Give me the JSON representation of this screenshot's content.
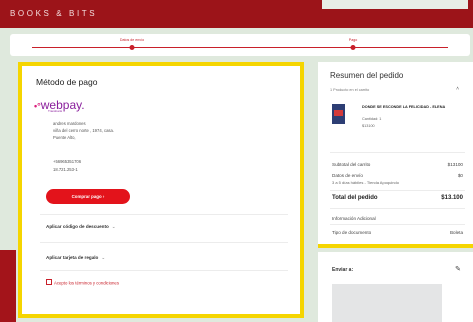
{
  "header": {
    "brand": "BOOKS & BITS"
  },
  "steps": [
    {
      "label": "Datos de envío"
    },
    {
      "label": "Pago"
    }
  ],
  "payment": {
    "title": "Método de pago",
    "provider": {
      "logo_prefix": "•°",
      "logo_text": "webpay.",
      "logo_sub": "Transbank"
    },
    "address_lines": [
      "andres mardones",
      "viña del cerro norte , 1974, casa.",
      "Puente Alto,"
    ],
    "contact_lines": [
      "+56965351706",
      "18.721.253-1"
    ],
    "pay_button": "Comprar pago  ›",
    "discount_link": "Aplicar código de descuento",
    "gift_link": "Aplicar tarjeta de regalo",
    "terms": "Acepto los términos y condiciones"
  },
  "summary": {
    "title": "Resumen del pedido",
    "count": "1 Producto en el carrito",
    "product": {
      "name": "DONDE SE ESCONDE LA FELICIDAD - ELENA",
      "qty": "Cantidad: 1",
      "price": "$13100"
    },
    "rows": [
      {
        "label": "Subtotal del carrito",
        "value": "$13100"
      },
      {
        "label": "Datos de envío",
        "value": "$0"
      }
    ],
    "shipping_note": "3 a 5 días hábiles - Tienda Apoquindo",
    "total": {
      "label": "Total del pedido",
      "value": "$13.100"
    },
    "info_label": "Información Adicional",
    "doc": {
      "label": "Tipo de documento",
      "value": "Boleta"
    }
  },
  "shipping": {
    "title": "Enviar a:"
  },
  "icons": {
    "caret": "˄",
    "chevron": "⌄",
    "pencil": "✎"
  },
  "colors": {
    "brand": "#9c1419",
    "accent": "#e3131b",
    "highlight": "#f5d500"
  }
}
